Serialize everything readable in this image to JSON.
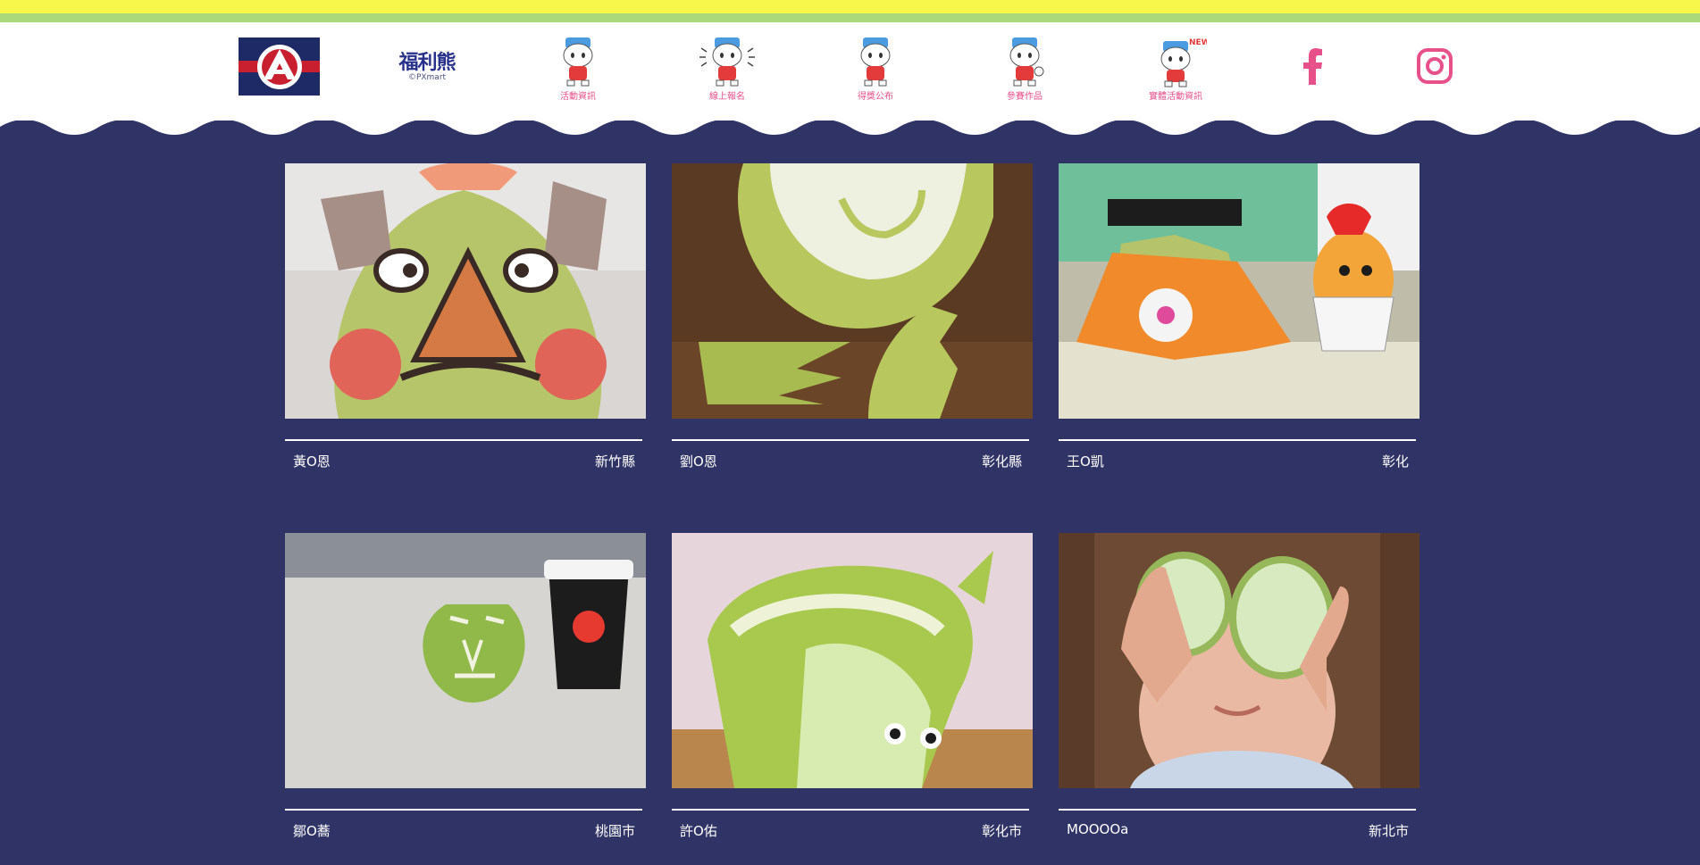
{
  "header": {
    "brand_logo_icon": "pxmart-logo",
    "bear_logo": {
      "name": "福利熊",
      "sub": "©PXmart"
    },
    "nav": [
      {
        "label": "活動資訊",
        "icon": "mascot-icon"
      },
      {
        "label": "線上報名",
        "icon": "mascot-waving-icon"
      },
      {
        "label": "得獎公布",
        "icon": "mascot-icon"
      },
      {
        "label": "參賽作品",
        "icon": "mascot-thumbs-up-icon"
      },
      {
        "label": "實體活動資訊",
        "icon": "mascot-new-icon",
        "badge": "NEW"
      }
    ],
    "social": [
      {
        "icon": "facebook-icon"
      },
      {
        "icon": "instagram-icon"
      }
    ]
  },
  "colors": {
    "background": "#2f3366",
    "stripe_yellow": "#f7f74b",
    "stripe_green": "#a9d97a",
    "nav_label": "#e8508a"
  },
  "entries": [
    {
      "name": "黃O恩",
      "region": "新竹縣",
      "photo": "pomelo-face-photo"
    },
    {
      "name": "劉O恩",
      "region": "彰化縣",
      "photo": "pomelo-carving-photo"
    },
    {
      "name": "王O凱",
      "region": "彰化",
      "photo": "pomelo-crafts-photo"
    },
    {
      "name": "鄒O蕎",
      "region": "桃園市",
      "photo": "pomelo-coffee-photo"
    },
    {
      "name": "許O佑",
      "region": "彰化市",
      "photo": "pomelo-dragon-photo"
    },
    {
      "name": "MOOOOa",
      "region": "新北市",
      "photo": "child-pomelo-eyes-photo"
    }
  ]
}
